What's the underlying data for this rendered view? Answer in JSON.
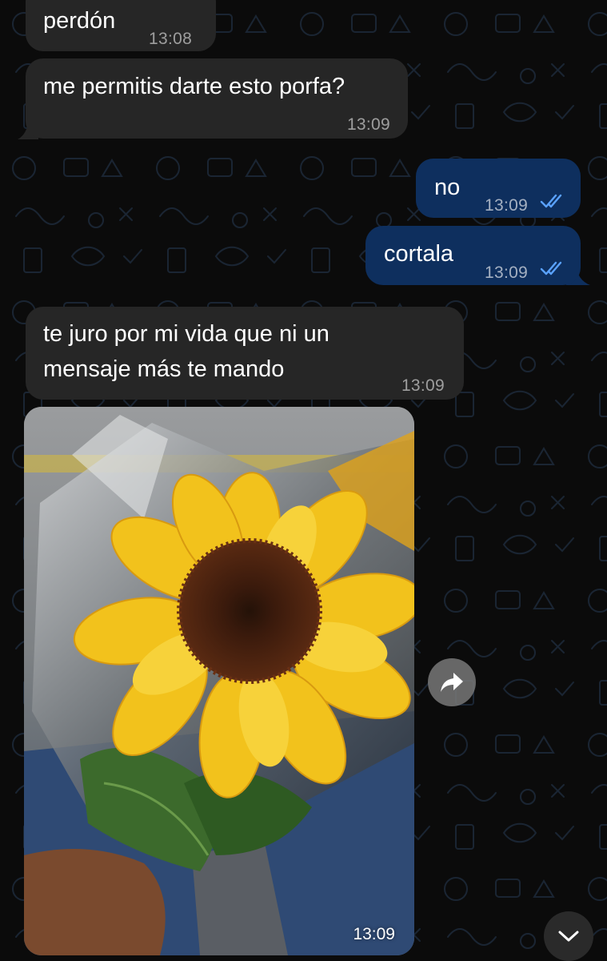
{
  "chat": {
    "messages": [
      {
        "direction": "incoming",
        "text": "perdón",
        "time": "13:08"
      },
      {
        "direction": "incoming",
        "text": "me permitis darte esto porfa?",
        "time": "13:09"
      },
      {
        "direction": "outgoing",
        "text": "no",
        "time": "13:09",
        "status": "read"
      },
      {
        "direction": "outgoing",
        "text": "cortala",
        "time": "13:09",
        "status": "read"
      },
      {
        "direction": "incoming",
        "text_line1": "te juro por mi vida que ni un",
        "text_line2": "mensaje más te mando",
        "time": "13:09"
      },
      {
        "direction": "incoming",
        "type": "image",
        "image_subject": "sunflower-bouquet",
        "time": "13:09"
      }
    ]
  },
  "icons": {
    "read_receipt": "double-check-icon",
    "forward": "forward-arrow-icon",
    "scroll_down": "chevron-down-icon"
  },
  "colors": {
    "background": "#0b0b0b",
    "incoming_bubble": "#262626",
    "outgoing_bubble": "#0e2f5e",
    "read_tick": "#5aa2ff"
  }
}
